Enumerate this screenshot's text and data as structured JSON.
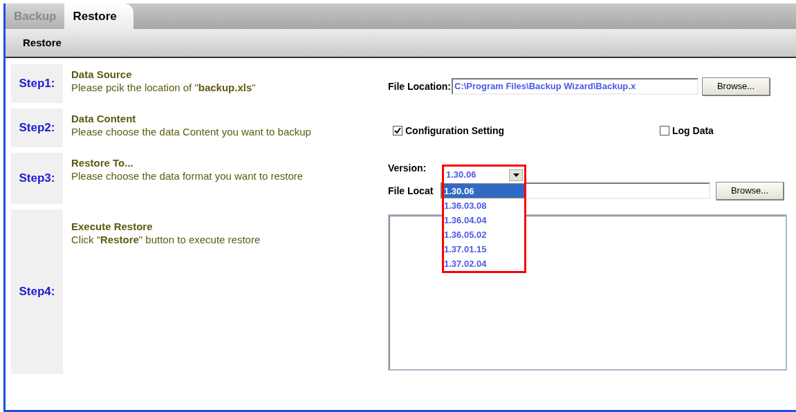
{
  "tabs": [
    {
      "label": "Backup",
      "selected": false
    },
    {
      "label": "Restore",
      "selected": true
    }
  ],
  "toolbar": {
    "title": "Restore"
  },
  "steps": [
    {
      "label": "Step1:",
      "title": "Data Source",
      "description": "Please pcik the location of \"**backup.xls**\""
    },
    {
      "label": "Step2:",
      "title": "Data Content",
      "description": "Please choose the data Content you want to backup"
    },
    {
      "label": "Step3:",
      "title": "Restore To...",
      "description": "Please choose the data format you want to restore"
    },
    {
      "label": "Step4:",
      "title": "Execute Restore",
      "description": "Click \"**Restore**\" button to execute restore"
    }
  ],
  "source_location": {
    "label": "File Location:",
    "value": "C:\\Program Files\\Backup Wizard\\Backup.x",
    "button": "Browse..."
  },
  "content_options": [
    {
      "label": "Configuration Setting",
      "checked": true
    },
    {
      "label": "Log Data",
      "checked": false
    }
  ],
  "version": {
    "label": "Version:",
    "value": "1.30.06",
    "expanded": true,
    "options": [
      {
        "label": "1.30.06",
        "selected": true
      },
      {
        "label": "1.36.03.08",
        "selected": false
      },
      {
        "label": "1.36.04.04",
        "selected": false
      },
      {
        "label": "1.36.05.02",
        "selected": false
      },
      {
        "label": "1.37.01.15",
        "selected": false
      },
      {
        "label": "1.37.02.04",
        "selected": false
      }
    ]
  },
  "restore_location": {
    "label": "File Locat",
    "button": "Browse..."
  }
}
